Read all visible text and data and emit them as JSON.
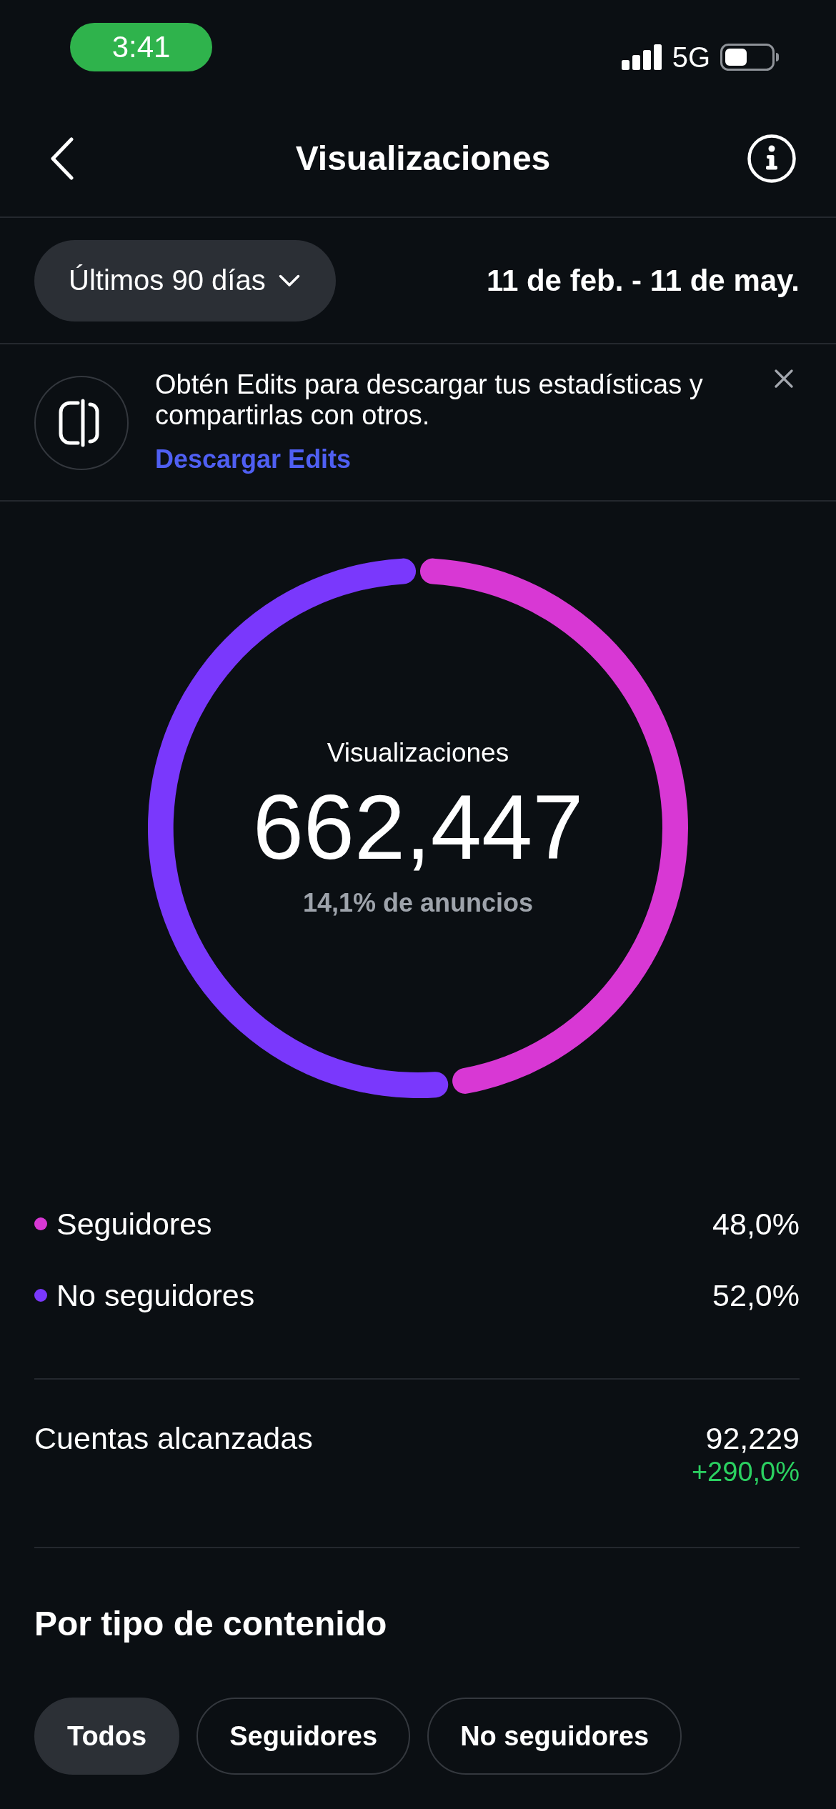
{
  "status_bar": {
    "time": "3:41",
    "network": "5G"
  },
  "header": {
    "title": "Visualizaciones"
  },
  "filter": {
    "period": "Últimos 90 días",
    "date_range": "11 de feb. - 11 de may."
  },
  "banner": {
    "message": "Obtén Edits para descargar tus estadísticas y compartirlas con otros.",
    "link": "Descargar Edits"
  },
  "summary": {
    "label": "Visualizaciones",
    "value": "662,447",
    "ads_share": "14,1% de anuncios",
    "chart_data": {
      "type": "donut",
      "values": [
        48.0,
        52.0
      ]
    }
  },
  "legend": [
    {
      "label": "Seguidores",
      "value": "48,0%",
      "color": "#d838d4"
    },
    {
      "label": "No seguidores",
      "value": "52,0%",
      "color": "#7a38fc"
    }
  ],
  "reach": {
    "label": "Cuentas alcanzadas",
    "value": "92,229",
    "change": "+290,0%"
  },
  "content_type": {
    "title": "Por tipo de contenido",
    "tabs": [
      {
        "label": "Todos",
        "selected": true
      },
      {
        "label": "Seguidores",
        "selected": false
      },
      {
        "label": "No seguidores",
        "selected": false
      }
    ]
  }
}
